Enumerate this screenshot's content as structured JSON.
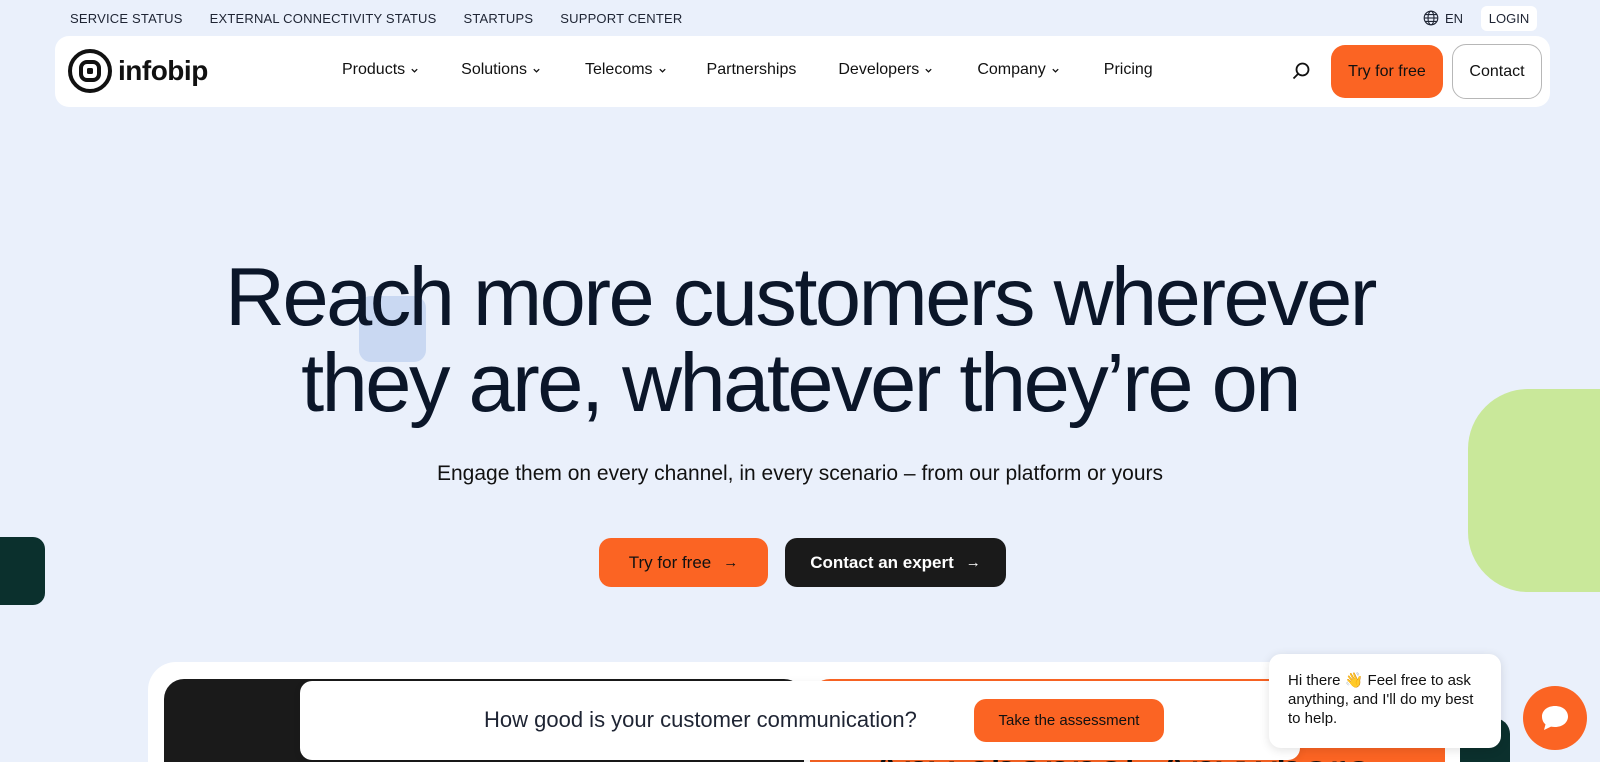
{
  "utility_bar": {
    "links": [
      "SERVICE STATUS",
      "EXTERNAL CONNECTIVITY STATUS",
      "STARTUPS",
      "SUPPORT CENTER"
    ],
    "language": "EN",
    "login": "LOGIN"
  },
  "nav": {
    "logo_text": "infobip",
    "items": [
      {
        "label": "Products",
        "dropdown": true
      },
      {
        "label": "Solutions",
        "dropdown": true
      },
      {
        "label": "Telecoms",
        "dropdown": true
      },
      {
        "label": "Partnerships",
        "dropdown": false
      },
      {
        "label": "Developers",
        "dropdown": true
      },
      {
        "label": "Company",
        "dropdown": true
      },
      {
        "label": "Pricing",
        "dropdown": false
      }
    ],
    "try_label": "Try for free",
    "contact_label": "Contact"
  },
  "hero": {
    "title_line1": "Reach more customers wherever",
    "title_line2": "they are, whatever they’re on",
    "subtitle": "Engage them on every channel, in every scenario – from our platform or yours",
    "cta_try": "Try for free",
    "cta_contact": "Contact an expert"
  },
  "preview": {
    "orange_text": "Any channel. Anywhere."
  },
  "assessment": {
    "text": "How good is your customer communication?",
    "button": "Take the assessment"
  },
  "chat": {
    "message": "Hi there 👋 Feel free to ask anything, and I'll do my best to help."
  },
  "colors": {
    "background": "#eaf0fb",
    "accent_orange": "#fb6423",
    "dark": "#1a1a1a",
    "teal_dark": "#0b302d",
    "lime": "#c9e89a"
  }
}
